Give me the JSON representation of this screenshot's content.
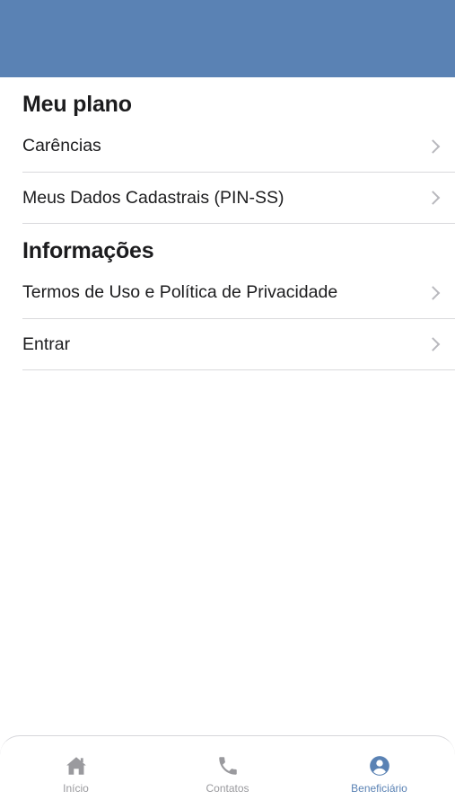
{
  "sections": [
    {
      "title": "Meu plano",
      "items": [
        {
          "label": "Carências"
        },
        {
          "label": "Meus Dados Cadastrais (PIN-SS)"
        }
      ]
    },
    {
      "title": "Informações",
      "items": [
        {
          "label": "Termos de Uso e Política de Privacidade"
        },
        {
          "label": "Entrar"
        }
      ]
    }
  ],
  "tabbar": {
    "tabs": [
      {
        "label": "Início",
        "icon": "home-icon",
        "active": false
      },
      {
        "label": "Contatos",
        "icon": "phone-icon",
        "active": false
      },
      {
        "label": "Beneficiário",
        "icon": "user-circle-icon",
        "active": true
      }
    ]
  },
  "colors": {
    "header": "#5a82b4",
    "accent": "#5a82b4",
    "inactive": "#9a9a9e",
    "divider": "#d9d9dc"
  }
}
